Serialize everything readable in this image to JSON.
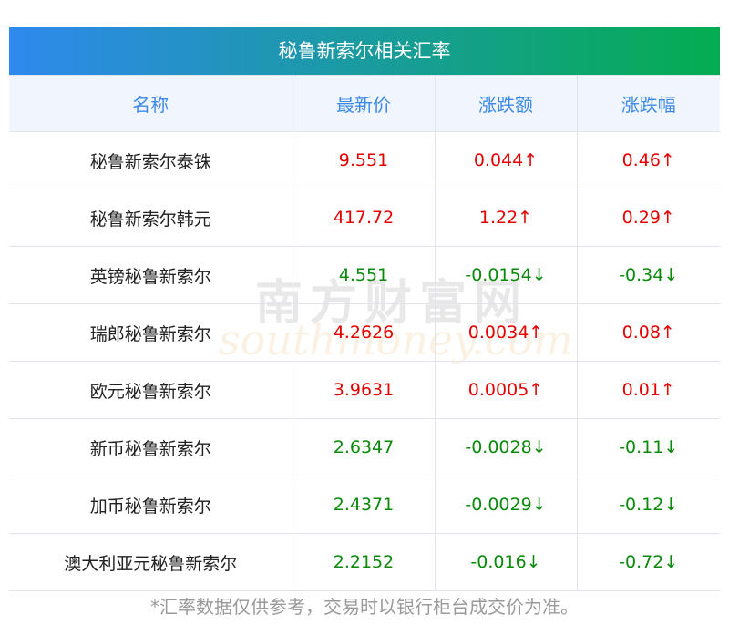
{
  "title": "秘鲁新索尔相关汇率",
  "headers": [
    "名称",
    "最新价",
    "涨跌额",
    "涨跌幅"
  ],
  "rows": [
    {
      "name": "秘鲁新索尔泰铢",
      "price": "9.551",
      "change": "0.044↑",
      "pct": "0.46↑",
      "dir": "up"
    },
    {
      "name": "秘鲁新索尔韩元",
      "price": "417.72",
      "change": "1.22↑",
      "pct": "0.29↑",
      "dir": "up"
    },
    {
      "name": "英镑秘鲁新索尔",
      "price": "4.551",
      "change": "-0.0154↓",
      "pct": "-0.34↓",
      "dir": "down"
    },
    {
      "name": "瑞郎秘鲁新索尔",
      "price": "4.2626",
      "change": "0.0034↑",
      "pct": "0.08↑",
      "dir": "up"
    },
    {
      "name": "欧元秘鲁新索尔",
      "price": "3.9631",
      "change": "0.0005↑",
      "pct": "0.01↑",
      "dir": "up"
    },
    {
      "name": "新币秘鲁新索尔",
      "price": "2.6347",
      "change": "-0.0028↓",
      "pct": "-0.11↓",
      "dir": "down"
    },
    {
      "name": "加币秘鲁新索尔",
      "price": "2.4371",
      "change": "-0.0029↓",
      "pct": "-0.12↓",
      "dir": "down"
    },
    {
      "name": "澳大利亚元秘鲁新索尔",
      "price": "2.2152",
      "change": "-0.016↓",
      "pct": "-0.72↓",
      "dir": "down"
    }
  ],
  "footer": "*汇率数据仅供参考，交易时以银行柜台成交价为准。",
  "watermark": {
    "cn": "南方财富网",
    "en": "southmoney.com"
  },
  "colors": {
    "up": "#e60000",
    "down": "#0a8a0a",
    "header_text": "#3d8ae6"
  }
}
